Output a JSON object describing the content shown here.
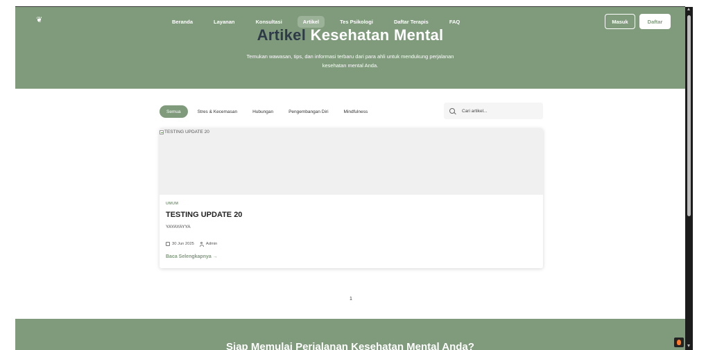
{
  "brand": {
    "logo_icon": "lotus-icon"
  },
  "nav": {
    "items": [
      {
        "label": "Beranda",
        "active": false
      },
      {
        "label": "Layanan",
        "active": false
      },
      {
        "label": "Konsultasi",
        "active": false
      },
      {
        "label": "Artikel",
        "active": true
      },
      {
        "label": "Tes Psikologi",
        "active": false
      },
      {
        "label": "Daftar Terapis",
        "active": false
      },
      {
        "label": "FAQ",
        "active": false
      }
    ],
    "login_label": "Masuk",
    "register_label": "Daftar"
  },
  "hero": {
    "title_dark": "Artikel",
    "title_light": "Kesehatan Mental",
    "subtitle": "Temukan wawasan, tips, dan informasi terbaru dari para ahli untuk mendukung perjalanan kesehatan mental Anda."
  },
  "filters": {
    "items": [
      {
        "label": "Semua",
        "active": true
      },
      {
        "label": "Stres & Kecemasan",
        "active": false
      },
      {
        "label": "Hubungan",
        "active": false
      },
      {
        "label": "Pengembangan Diri",
        "active": false
      },
      {
        "label": "Mindfulness",
        "active": false
      }
    ]
  },
  "search": {
    "placeholder": "Cari artikel..."
  },
  "article": {
    "image_alt": "TESTING UPDATE 20",
    "category": "UMUM",
    "title": "TESTING UPDATE 20",
    "excerpt": "YAYAYAYYA",
    "date": "30 Jun 2025",
    "author": "Admin",
    "read_more": "Baca Selengkapnya →"
  },
  "pagination": {
    "current": "1"
  },
  "cta": {
    "title": "Siap Memulai Perjalanan Kesehatan Mental Anda?"
  },
  "colors": {
    "primary": "#7f9b7c",
    "dark_title": "#2e3a48"
  }
}
